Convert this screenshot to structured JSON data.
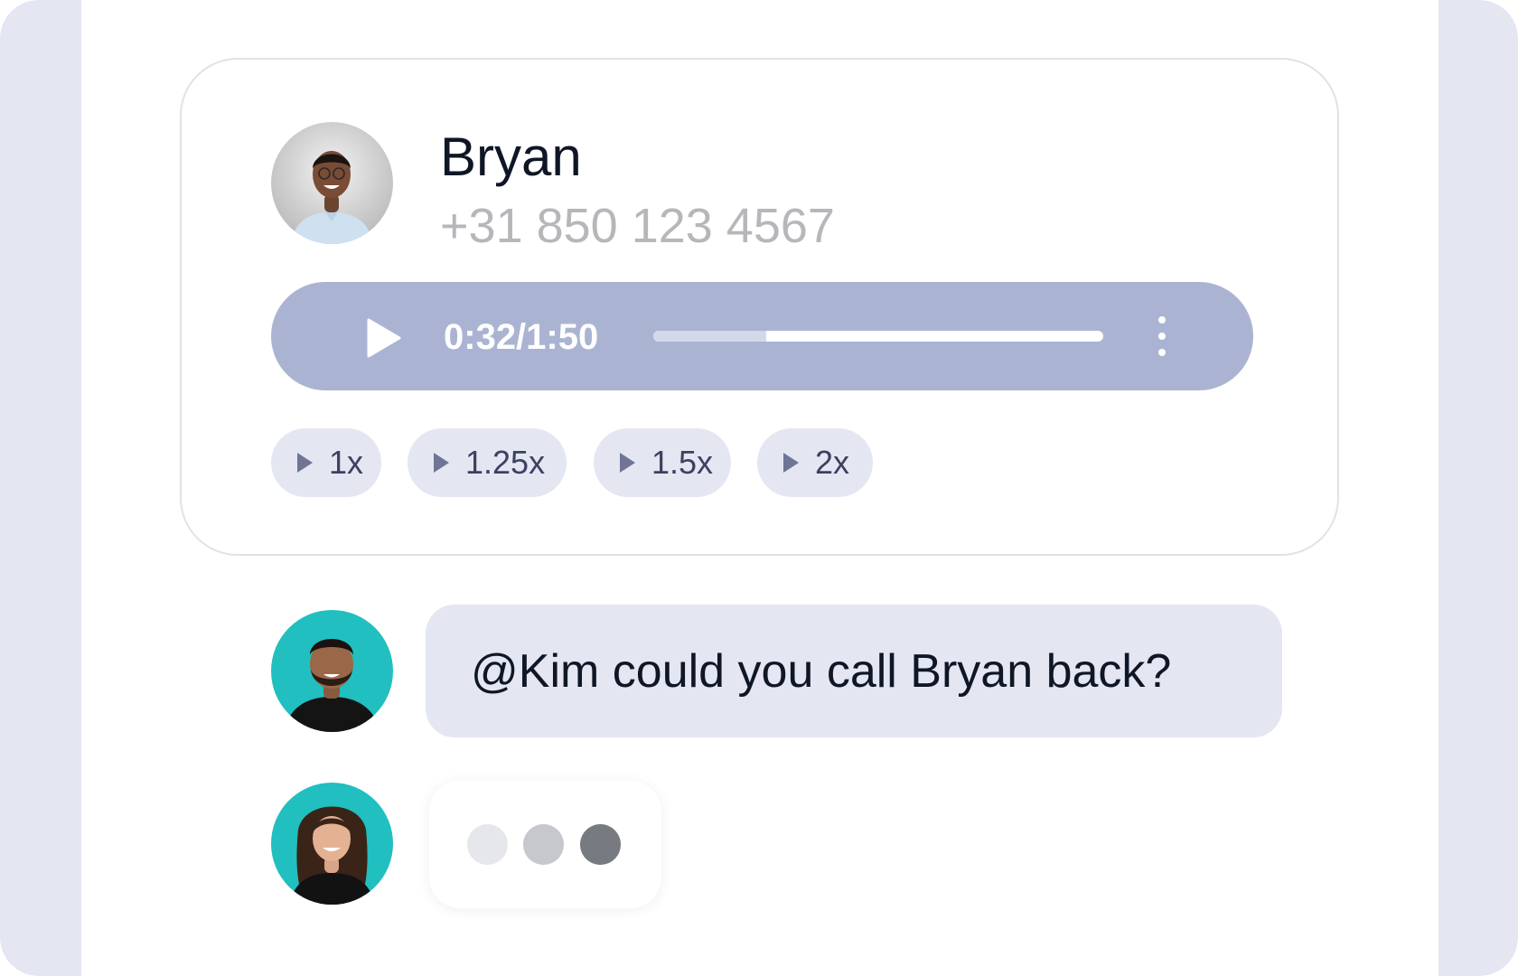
{
  "caller": {
    "name": "Bryan",
    "phone": "+31 850 123 4567",
    "avatar_icon": "person-avatar-icon"
  },
  "player": {
    "time": "0:32/1:50",
    "progress": 0.25,
    "play_icon": "play-icon",
    "more_icon": "more-vertical-icon"
  },
  "speeds": [
    {
      "label": "1x",
      "icon": "play-icon"
    },
    {
      "label": "1.25x",
      "icon": "play-icon"
    },
    {
      "label": "1.5x",
      "icon": "play-icon"
    },
    {
      "label": "2x",
      "icon": "play-icon"
    }
  ],
  "chat": {
    "message": "@Kim could you call Bryan back?",
    "typing_dots": 3
  },
  "colors": {
    "background": "#e4e6f2",
    "player": "#aab4d2",
    "avatar_teal": "#21bfbf",
    "text_dark": "#0f1726",
    "text_muted": "#b6b6bb"
  }
}
